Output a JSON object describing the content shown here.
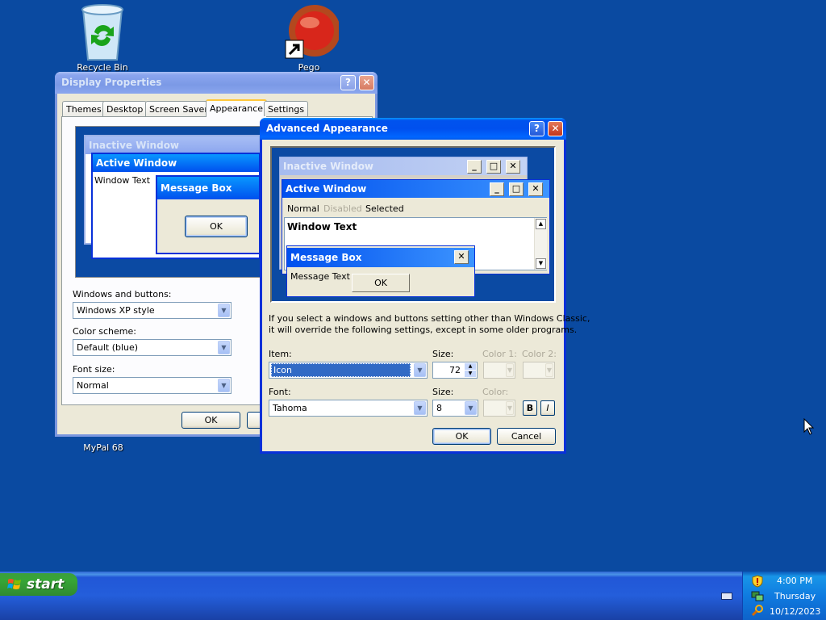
{
  "desktop": {
    "icons": [
      {
        "label": "Recycle Bin"
      },
      {
        "label": "Pego"
      },
      {
        "label": "MyPal 68"
      }
    ]
  },
  "display_properties": {
    "title": "Display Properties",
    "tabs": [
      "Themes",
      "Desktop",
      "Screen Saver",
      "Appearance",
      "Settings"
    ],
    "active_tab": "Appearance",
    "preview": {
      "inactive_title": "Inactive Window",
      "active_title": "Active Window",
      "window_text": "Window Text",
      "message_box_title": "Message Box",
      "ok_label": "OK"
    },
    "windows_buttons_label": "Windows and buttons:",
    "windows_buttons_value": "Windows XP style",
    "color_scheme_label": "Color scheme:",
    "color_scheme_value": "Default (blue)",
    "font_size_label": "Font size:",
    "font_size_value": "Normal",
    "ok_label": "OK"
  },
  "advanced_appearance": {
    "title": "Advanced Appearance",
    "preview": {
      "inactive_title": "Inactive Window",
      "active_title": "Active Window",
      "menu": [
        "Normal",
        "Disabled",
        "Selected"
      ],
      "window_text": "Window Text",
      "message_box_title": "Message Box",
      "message_text": "Message Text",
      "ok_label": "OK"
    },
    "info_line1": "If you select a windows and buttons setting other than Windows Classic,",
    "info_line2": "it will override the following settings, except in some older programs.",
    "item_label": "Item:",
    "item_value": "Icon",
    "size_label": "Size:",
    "item_size_value": "72",
    "color1_label": "Color 1:",
    "color2_label": "Color 2:",
    "font_label": "Font:",
    "font_value": "Tahoma",
    "font_size_label": "Size:",
    "font_size_value": "8",
    "color_label": "Color:",
    "bold_label": "B",
    "italic_label": "I",
    "ok_label": "OK",
    "cancel_label": "Cancel"
  },
  "taskbar": {
    "start_label": "start",
    "time": "4:00 PM",
    "day": "Thursday",
    "date": "10/12/2023"
  },
  "colors": {
    "desktop": "#0a4aa1",
    "title_active": "#0053ee",
    "preview_bg": "#0b4aa3"
  }
}
